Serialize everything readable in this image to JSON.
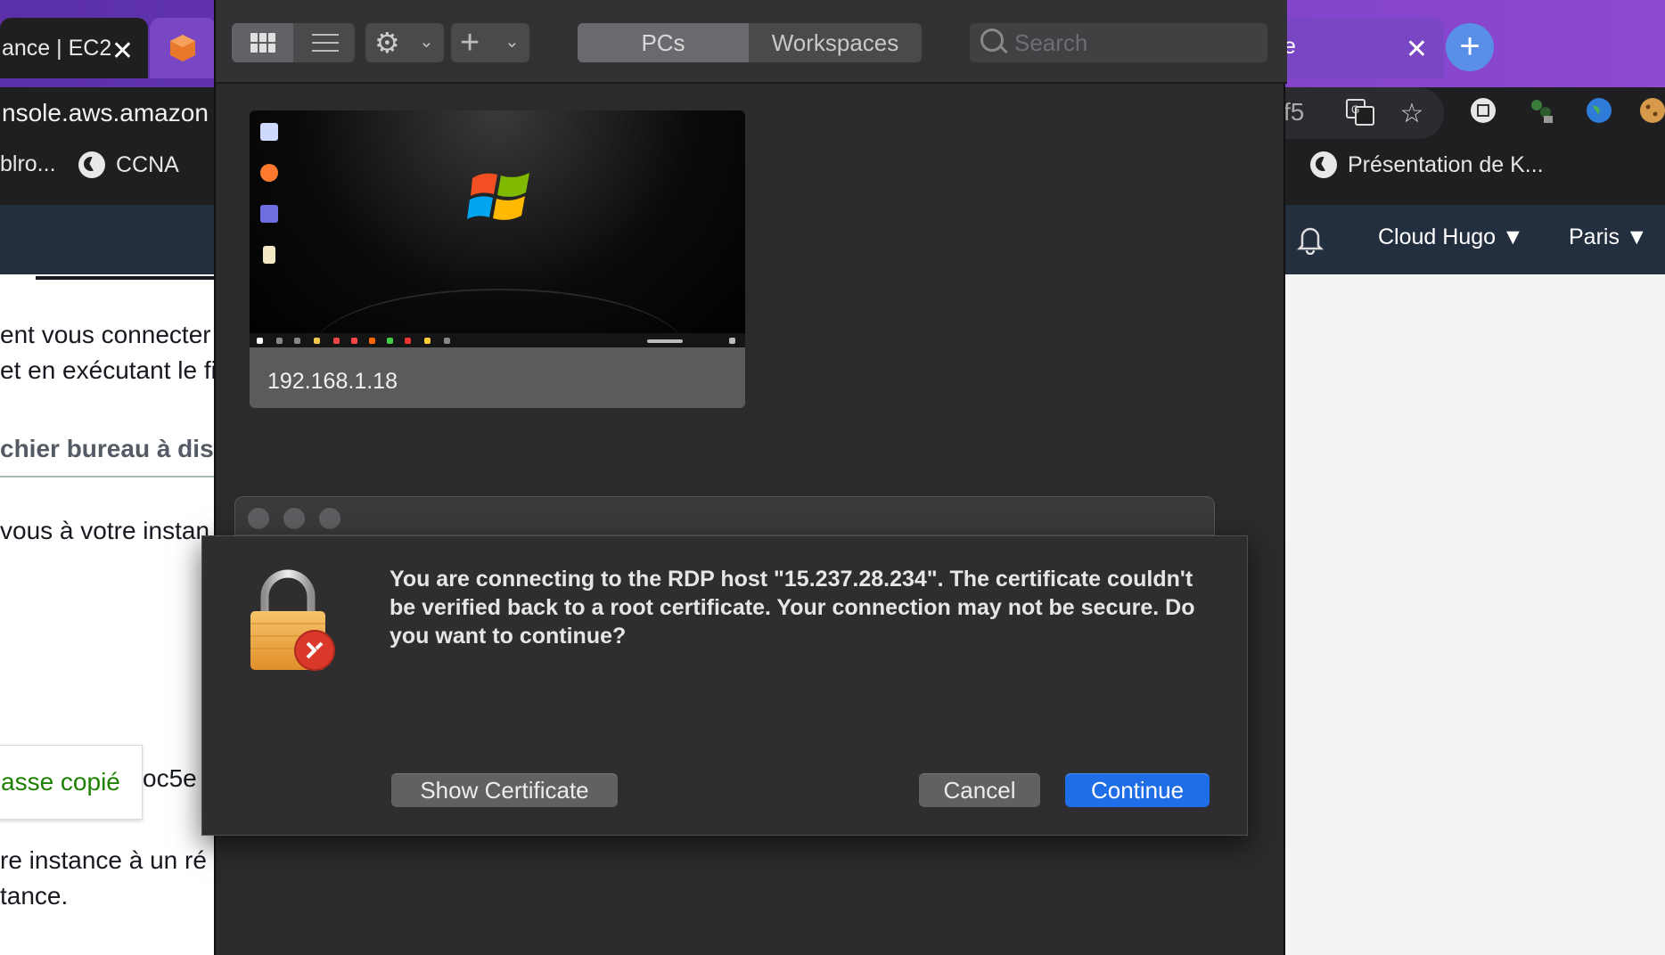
{
  "browser": {
    "tabs": [
      {
        "label": "ance | EC2"
      },
      {
        "label": ""
      },
      {
        "label": "e"
      }
    ],
    "address": "nsole.aws.amazon",
    "address_right": "f5",
    "bookmarks": [
      {
        "label": "blro..."
      },
      {
        "label": "CCNA"
      },
      {
        "label": "Présentation de K..."
      }
    ]
  },
  "aws": {
    "account": "Cloud Hugo ▼",
    "region": "Paris ▼",
    "lines": [
      "ent vous connecter",
      "et en exécutant le fi",
      "vous à votre instan",
      "re instance à un ré",
      "tance."
    ],
    "heading": "chier bureau à dis",
    "copied": "asse copié",
    "copied_tail": "oc5e"
  },
  "remote_desktop": {
    "tabs": {
      "pcs": "PCs",
      "workspaces": "Workspaces"
    },
    "search_placeholder": "Search",
    "pc": {
      "label": "192.168.1.18"
    }
  },
  "dialog": {
    "message": "You are connecting to the RDP host \"15.237.28.234\". The certificate couldn't be verified back to a root certificate. Your connection may not be secure. Do you want to continue?",
    "show_certificate": "Show Certificate",
    "cancel": "Cancel",
    "continue": "Continue"
  },
  "colors": {
    "accent": "#1f6ee8",
    "aws_header": "#232f3e",
    "success": "#1d8102"
  }
}
